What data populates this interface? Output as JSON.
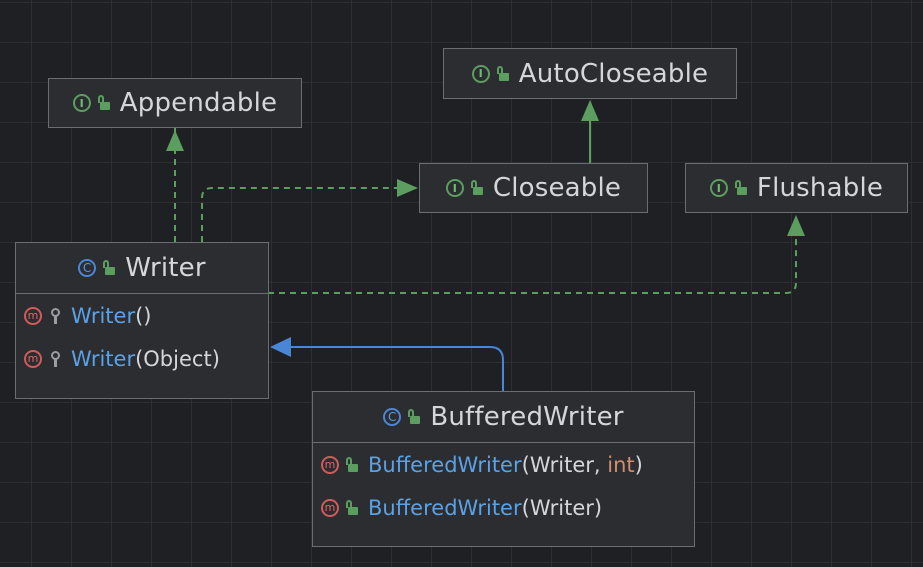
{
  "nodes": {
    "appendable": {
      "kind": "interface",
      "name": "Appendable"
    },
    "autocloseable": {
      "kind": "interface",
      "name": "AutoCloseable"
    },
    "closeable": {
      "kind": "interface",
      "name": "Closeable"
    },
    "flushable": {
      "kind": "interface",
      "name": "Flushable"
    },
    "writer": {
      "kind": "class",
      "name": "Writer",
      "members": [
        {
          "name": "Writer",
          "args": "()"
        },
        {
          "name": "Writer",
          "args_open": "(",
          "param1": "Object",
          "args_close": ")"
        }
      ]
    },
    "bufferedwriter": {
      "kind": "class",
      "name": "BufferedWriter",
      "members": [
        {
          "name": "BufferedWriter",
          "args_open": "(",
          "param1": "Writer",
          "sep": ", ",
          "param2": "int",
          "args_close": ")"
        },
        {
          "name": "BufferedWriter",
          "args_open": "(",
          "param1": "Writer",
          "args_close": ")"
        }
      ]
    }
  },
  "icons": {
    "interface": "I",
    "class": "C",
    "method": "m"
  },
  "colors": {
    "background": "#1f2023",
    "node_fill": "#2b2d30",
    "border": "#6a6d72",
    "text": "#d4d6da",
    "method_name": "#5aa1e6",
    "keyword": "#cf8e6d",
    "implements_edge": "#5b9e5f",
    "extends_edge": "#4a86d6",
    "method_icon": "#d05b5b"
  },
  "edges": [
    {
      "from": "Writer",
      "to": "Appendable",
      "type": "implements"
    },
    {
      "from": "Writer",
      "to": "Closeable",
      "type": "implements"
    },
    {
      "from": "Writer",
      "to": "Flushable",
      "type": "implements"
    },
    {
      "from": "Closeable",
      "to": "AutoCloseable",
      "type": "extends"
    },
    {
      "from": "BufferedWriter",
      "to": "Writer",
      "type": "extends"
    }
  ]
}
